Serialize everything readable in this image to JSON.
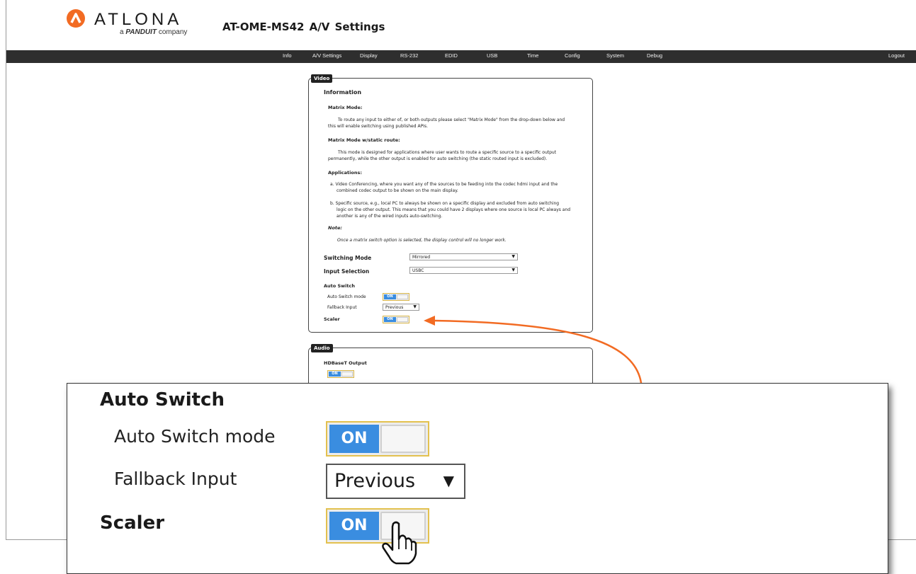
{
  "brand": {
    "name": "ATLONA",
    "sub_prefix": "a",
    "sub_brand": "PANDUIT",
    "sub_suffix": "company",
    "colors": {
      "accent": "#f26b23",
      "toggle_on": "#3a8de0",
      "navbar": "#2e2e2e"
    }
  },
  "page": {
    "title": "AT-OME-MS42  A/V Settings"
  },
  "nav": {
    "items": [
      "Info",
      "A/V Settings",
      "Display",
      "RS-232",
      "EDID",
      "USB",
      "Time",
      "Config",
      "System",
      "Debug"
    ],
    "logout": "Logout"
  },
  "video": {
    "legend": "Video",
    "info_heading": "Information",
    "matrix_mode_heading": "Matrix Mode:",
    "matrix_mode_line1": "To route any input to either of, or both outputs please select \"Matrix Mode\" from the drop-down below and",
    "matrix_mode_line2": "this will enable switching using published APIs.",
    "static_heading": "Matrix Mode w/static route:",
    "static_line1": "This mode is designed for applications where user wants to route a specific source to a specific output",
    "static_line2": "permanently, while the other output is enabled for auto switching (the static routed input is excluded).",
    "apps_heading": "Applications:",
    "app_a_line1": "a.  Video Conferencing, where you want any of the sources to be feeding into the codec hdmi input and the",
    "app_a_line2": "combined codec output to be shown on the main display.",
    "app_b_line1": "b.  Specific source, e.g., local PC to always be shown on a specific display and excluded from auto switching",
    "app_b_line2": "logic on the other output. This means that you could have 2 displays where one source is local PC always and",
    "app_b_line3": "another is any of the wired inputs auto-switching.",
    "note_heading": "Note:",
    "note_line": "Once a matrix switch option is selected, the display control will no longer work.",
    "switching_mode_label": "Switching Mode",
    "switching_mode_value": "Mirrored",
    "input_selection_label": "Input Selection",
    "input_selection_value": "USBC",
    "auto_switch_heading": "Auto Switch",
    "auto_switch_mode_label": "Auto Switch mode",
    "auto_switch_mode_state": "ON",
    "fallback_label": "Fallback Input",
    "fallback_value": "Previous",
    "scaler_label": "Scaler",
    "scaler_state": "ON"
  },
  "audio": {
    "legend": "Audio",
    "hdbaset_label": "HDBaseT Output",
    "hdbaset_state": "ON"
  },
  "zoom": {
    "auto_switch_heading": "Auto Switch",
    "auto_switch_mode_label": "Auto Switch mode",
    "auto_switch_mode_state": "ON",
    "fallback_label": "Fallback Input",
    "fallback_value": "Previous",
    "scaler_label": "Scaler",
    "scaler_state": "ON",
    "cursor_icon": "hand-pointer-icon"
  }
}
